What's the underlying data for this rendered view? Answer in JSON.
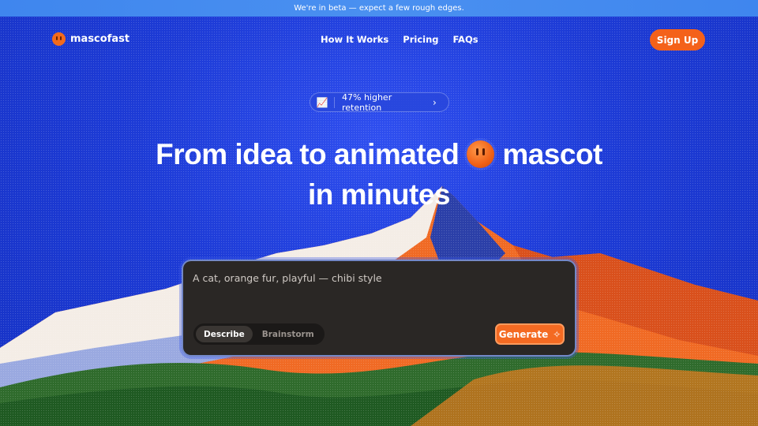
{
  "banner": {
    "text": "We're in beta — expect a few rough edges."
  },
  "brand": {
    "name": "mascofast",
    "accent": "#f4611a"
  },
  "nav": {
    "links": [
      {
        "label": "How It Works"
      },
      {
        "label": "Pricing"
      },
      {
        "label": "FAQs"
      }
    ],
    "signup_label": "Sign Up"
  },
  "announcement": {
    "icon": "📈",
    "text": "47% higher retention",
    "chevron": "›"
  },
  "hero": {
    "line1_before": "From idea to animated",
    "line1_after": "mascot",
    "line2": "in minutes"
  },
  "composer": {
    "prompt_value": "A cat, orange fur, playful — chibi style",
    "modes": [
      {
        "label": "Describe",
        "active": true
      },
      {
        "label": "Brainstorm",
        "active": false
      }
    ],
    "generate_label": "Generate",
    "generate_icon": "✧"
  }
}
